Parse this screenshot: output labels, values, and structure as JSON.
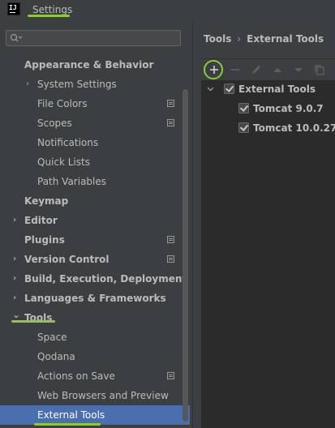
{
  "titlebar": {
    "app_icon_text": "IJ",
    "title": "Settings"
  },
  "search": {
    "value": "",
    "placeholder": ""
  },
  "sidebar": {
    "items": [
      {
        "label": "Appearance & Behavior",
        "arrow": "",
        "bold": true
      },
      {
        "label": "System Settings",
        "arrow": "›",
        "bold": false
      },
      {
        "label": "File Colors",
        "arrow": "",
        "bold": false
      },
      {
        "label": "Scopes",
        "arrow": "",
        "bold": false
      },
      {
        "label": "Notifications",
        "arrow": "",
        "bold": false
      },
      {
        "label": "Quick Lists",
        "arrow": "",
        "bold": false
      },
      {
        "label": "Path Variables",
        "arrow": "",
        "bold": false
      },
      {
        "label": "Keymap",
        "arrow": "",
        "bold": true
      },
      {
        "label": "Editor",
        "arrow": "›",
        "bold": true
      },
      {
        "label": "Plugins",
        "arrow": "",
        "bold": true
      },
      {
        "label": "Version Control",
        "arrow": "›",
        "bold": true
      },
      {
        "label": "Build, Execution, Deployment",
        "arrow": "›",
        "bold": true
      },
      {
        "label": "Languages & Frameworks",
        "arrow": "›",
        "bold": true
      },
      {
        "label": "Tools",
        "arrow": "⌄",
        "bold": true
      },
      {
        "label": "Space",
        "arrow": "",
        "bold": false
      },
      {
        "label": "Qodana",
        "arrow": "",
        "bold": false
      },
      {
        "label": "Actions on Save",
        "arrow": "",
        "bold": false
      },
      {
        "label": "Web Browsers and Preview",
        "arrow": "",
        "bold": false
      },
      {
        "label": "External Tools",
        "arrow": "",
        "bold": false,
        "selected": true
      }
    ]
  },
  "breadcrumb": {
    "parent": "Tools",
    "separator": "›",
    "current": "External Tools"
  },
  "toolbar": {
    "buttons": [
      "add-icon",
      "remove-icon",
      "edit-icon",
      "move-up-icon",
      "move-down-icon",
      "copy-icon"
    ]
  },
  "tree": {
    "group": {
      "label": "External Tools",
      "checked": true
    },
    "children": [
      {
        "label": "Tomcat 9.0.7",
        "checked": true
      },
      {
        "label": "Tomcat 10.0.27",
        "checked": true
      }
    ]
  },
  "colors": {
    "accent_highlight": "#8fc83a",
    "selection": "#4b6eaf",
    "panel_bg": "#3c3f41",
    "tree_bg": "#2b2b2b"
  }
}
